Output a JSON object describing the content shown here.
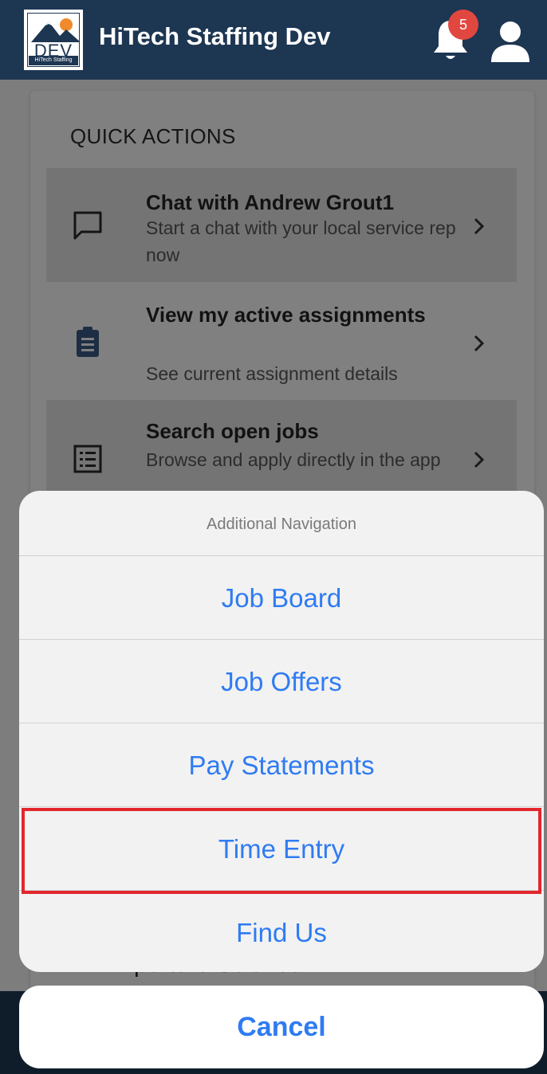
{
  "header": {
    "app_title": "HiTech Staffing Dev",
    "logo_text": "DEV",
    "logo_subtitle": "HiTech Staffing",
    "notification_count": "5",
    "bell_icon": "bell-icon",
    "profile_icon": "user-icon"
  },
  "quick_actions": {
    "title": "QUICK ACTIONS",
    "items": [
      {
        "title": "Chat with Andrew Grout1",
        "subtitle": "Start a chat with your local service rep now",
        "icon": "chat-icon"
      },
      {
        "title": "View my active assignments",
        "subtitle": "See current assignment details",
        "icon": "clipboard-icon"
      },
      {
        "title": "Search open jobs",
        "subtitle": "Browse and apply directly in the app",
        "icon": "list-icon"
      }
    ]
  },
  "background_text": "Aperture Science",
  "action_sheet": {
    "title": "Additional Navigation",
    "items": [
      {
        "label": "Job Board"
      },
      {
        "label": "Job Offers"
      },
      {
        "label": "Pay Statements"
      },
      {
        "label": "Time Entry",
        "highlighted": true
      },
      {
        "label": "Find Us"
      }
    ],
    "cancel_label": "Cancel"
  },
  "colors": {
    "header_bg": "#1d3652",
    "link_blue": "#2f7bf3",
    "badge_red": "#e0473f",
    "highlight_red": "#e3262d"
  }
}
